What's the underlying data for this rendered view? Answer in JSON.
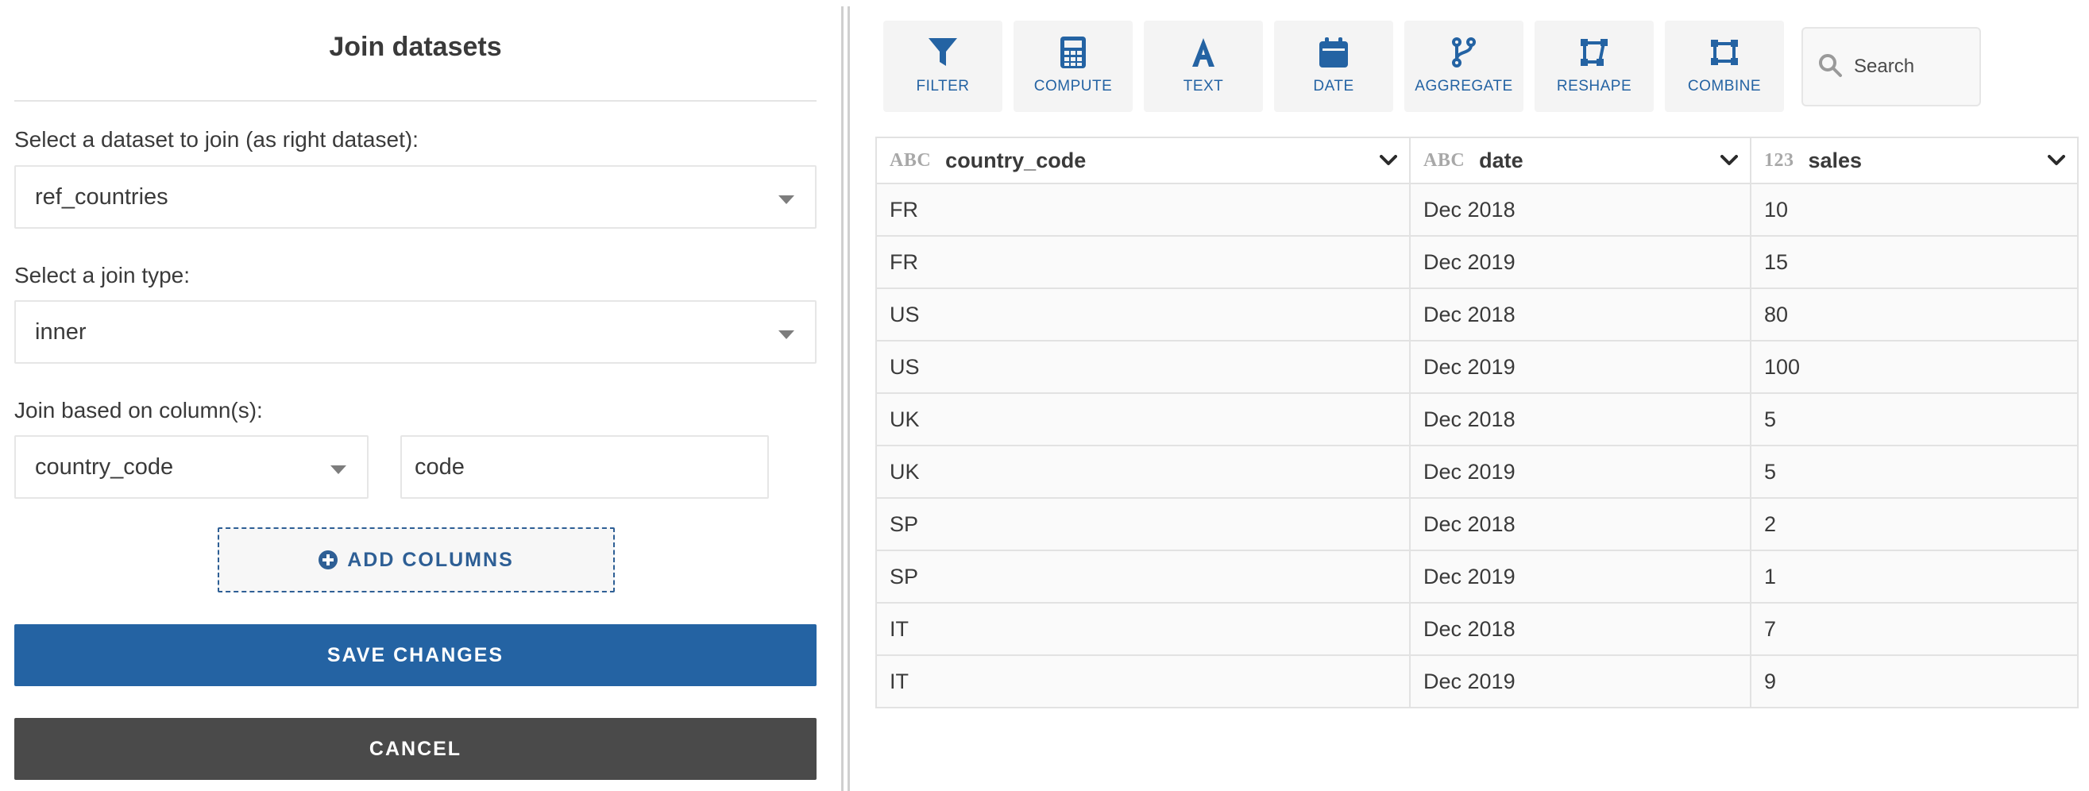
{
  "join_panel": {
    "title": "Join datasets",
    "dataset_label": "Select a dataset to join (as right dataset):",
    "dataset_value": "ref_countries",
    "join_type_label": "Select a join type:",
    "join_type_value": "inner",
    "columns_label": "Join based on column(s):",
    "left_column_value": "country_code",
    "right_column_value": "code",
    "add_columns_label": "ADD COLUMNS",
    "save_label": "SAVE CHANGES",
    "cancel_label": "CANCEL"
  },
  "toolbar": {
    "items": [
      {
        "label": "FILTER",
        "icon": "filter-icon"
      },
      {
        "label": "COMPUTE",
        "icon": "calculator-icon"
      },
      {
        "label": "TEXT",
        "icon": "text-icon"
      },
      {
        "label": "DATE",
        "icon": "calendar-icon"
      },
      {
        "label": "AGGREGATE",
        "icon": "aggregate-icon"
      },
      {
        "label": "RESHAPE",
        "icon": "reshape-icon"
      },
      {
        "label": "COMBINE",
        "icon": "combine-icon"
      }
    ],
    "search_placeholder": "Search"
  },
  "table": {
    "columns": [
      {
        "type": "ABC",
        "name": "country_code"
      },
      {
        "type": "ABC",
        "name": "date"
      },
      {
        "type": "123",
        "name": "sales"
      }
    ],
    "rows": [
      [
        "FR",
        "Dec 2018",
        "10"
      ],
      [
        "FR",
        "Dec 2019",
        "15"
      ],
      [
        "US",
        "Dec 2018",
        "80"
      ],
      [
        "US",
        "Dec 2019",
        "100"
      ],
      [
        "UK",
        "Dec 2018",
        "5"
      ],
      [
        "UK",
        "Dec 2019",
        "5"
      ],
      [
        "SP",
        "Dec 2018",
        "2"
      ],
      [
        "SP",
        "Dec 2019",
        "1"
      ],
      [
        "IT",
        "Dec 2018",
        "7"
      ],
      [
        "IT",
        "Dec 2019",
        "9"
      ]
    ]
  },
  "colors": {
    "accent": "#2463a3",
    "cancel": "#4a4a4a",
    "border": "#e6e6e6"
  }
}
